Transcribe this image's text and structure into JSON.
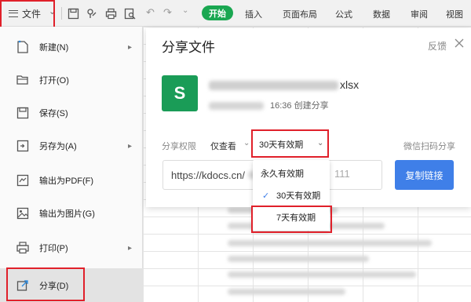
{
  "toolbar": {
    "file_label": "文件",
    "tabs": [
      "开始",
      "插入",
      "页面布局",
      "公式",
      "数据",
      "审阅",
      "视图"
    ]
  },
  "menu": {
    "items": [
      {
        "label": "新建(N)",
        "icon": "new-file-icon",
        "submenu": true
      },
      {
        "label": "打开(O)",
        "icon": "folder-open-icon",
        "submenu": false
      },
      {
        "label": "保存(S)",
        "icon": "save-icon",
        "submenu": false
      },
      {
        "label": "另存为(A)",
        "icon": "save-as-icon",
        "submenu": true
      },
      {
        "label": "输出为PDF(F)",
        "icon": "pdf-export-icon",
        "submenu": false
      },
      {
        "label": "输出为图片(G)",
        "icon": "image-export-icon",
        "submenu": false
      },
      {
        "label": "打印(P)",
        "icon": "printer-icon",
        "submenu": true
      },
      {
        "label": "分享(D)",
        "icon": "share-icon",
        "submenu": false,
        "active": true
      }
    ]
  },
  "share_panel": {
    "title": "分享文件",
    "feedback": "反馈",
    "file_ext": "xlsx",
    "file_meta": "16:36 创建分享",
    "perm_label": "分享权限",
    "perm_value": "仅查看",
    "validity_value": "30天有效期",
    "wechat_label": "微信扫码分享",
    "link_prefix": "https://kdocs.cn/",
    "link_suffix": "111",
    "copy_button": "复制链接",
    "logo_letter": "S"
  },
  "dropdown": {
    "options": [
      {
        "label": "永久有效期",
        "selected": false
      },
      {
        "label": "30天有效期",
        "selected": true
      },
      {
        "label": "7天有效期",
        "selected": false
      }
    ]
  },
  "colors": {
    "accent_green": "#1aa751",
    "accent_blue": "#3f7fe8",
    "highlight_red": "#e0202a"
  }
}
